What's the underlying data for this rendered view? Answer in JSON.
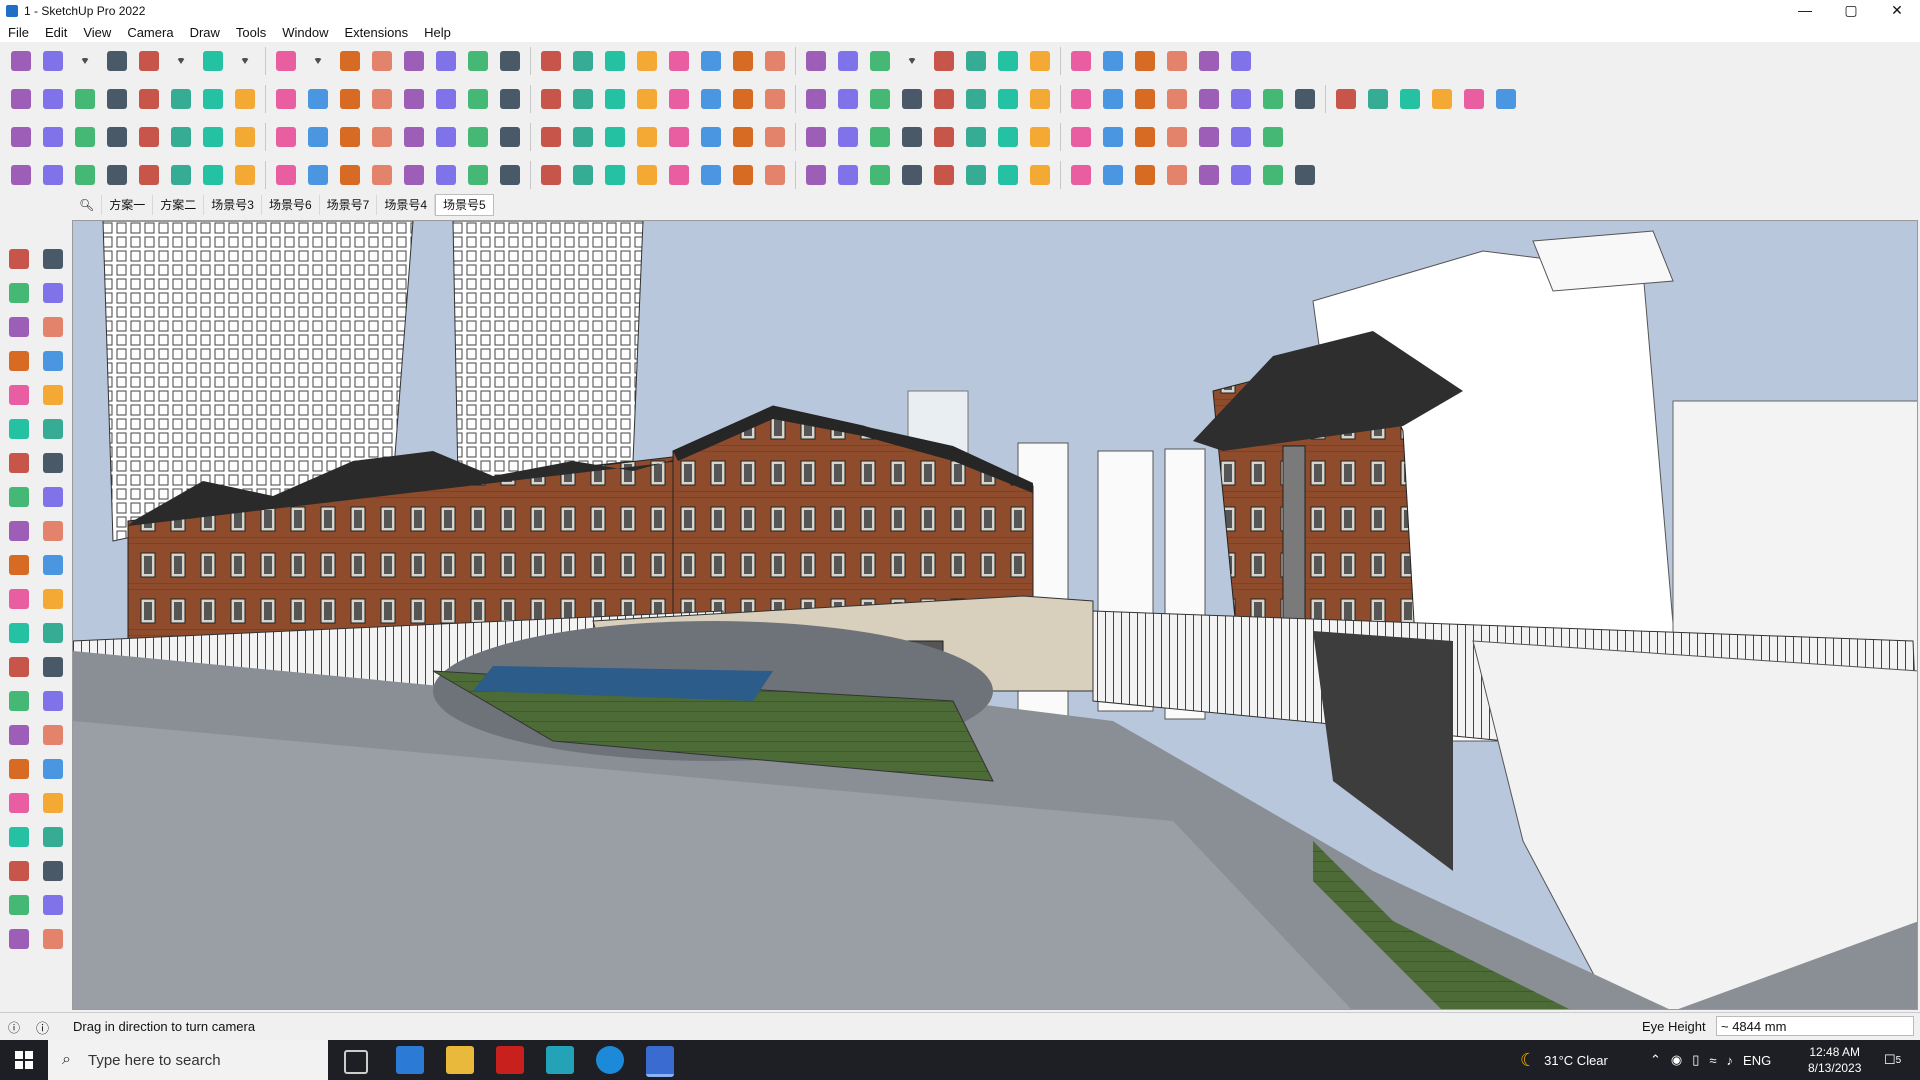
{
  "window": {
    "title": "1 - SketchUp Pro 2022",
    "minimize": "—",
    "maximize": "▢",
    "close": "✕"
  },
  "menu": [
    "File",
    "Edit",
    "View",
    "Camera",
    "Draw",
    "Tools",
    "Window",
    "Extensions",
    "Help"
  ],
  "toolbar_rows": {
    "row1": [
      "zoom-icon",
      "select-icon",
      "dropdown-icon",
      "eraser-icon",
      "line-icon",
      "dropdown-icon",
      "lasso-icon",
      "dropdown-icon",
      "rectangle-icon",
      "dropdown-icon",
      "push-pull-icon",
      "follow-me-icon",
      "move-icon",
      "rotate-icon",
      "scale-icon",
      "tape-measure-icon",
      "text-icon",
      "paint-bucket-icon",
      "orbit-icon",
      "pan-icon",
      "zoom-window-icon",
      "zoom-extents-icon",
      "iso-view-icon",
      "top-view-icon",
      "front-view-icon",
      "right-view-icon",
      "user-icon",
      "dropdown-icon",
      "warehouse-icon",
      "ext-warehouse-icon",
      "layout-icon",
      "upload-icon",
      "download-icon",
      "sandbox-icon",
      "section-icon",
      "undo-icon",
      "redo-icon",
      "ruby-icon"
    ],
    "row2": [
      "box-icon",
      "xray-icon",
      "hidden-line-icon",
      "tool-a-icon",
      "tool-b-icon",
      "tool-c-icon",
      "tool-d-icon",
      "tool-e-icon",
      "tool-f-icon",
      "tool-g-icon",
      "tool-h-icon",
      "arc-icon",
      "slash-a-icon",
      "slash-b-icon",
      "slash-c-icon",
      "shade-a-icon",
      "shade-b-icon",
      "house-a-icon",
      "house-b-icon",
      "house-c-icon",
      "house-d-icon",
      "house-e-icon",
      "house-f-icon",
      "font-icon",
      "hand-icon",
      "pen-icon",
      "shape-a-icon",
      "shape-b-icon",
      "shape-c-icon",
      "shape-d-icon",
      "shape-e-icon",
      "shape-f-icon",
      "shape-g-icon",
      "shape-h-icon",
      "shape-i-icon",
      "shape-j-icon",
      "shape-k-icon",
      "pencil-red-icon",
      "pencil-pink-icon",
      "misc-a-icon",
      "misc-b-icon",
      "misc-c-icon",
      "misc-d-icon",
      "misc-e-icon",
      "misc-f-icon",
      "misc-g-icon"
    ],
    "row3": [
      "r3-a-icon",
      "r3-b-icon",
      "r3-c-icon",
      "r3-d-icon",
      "r3-e-icon",
      "r3-f-icon",
      "r3-g-icon",
      "r3-h-icon",
      "r3-i-icon",
      "r3-j-icon",
      "r3-k-icon",
      "r3-l-icon",
      "r3-m-icon",
      "r3-n-icon",
      "r3-o-icon",
      "r3-p-icon",
      "r3-q-icon",
      "r3-r-icon",
      "r3-s-icon",
      "r3-t-icon",
      "r3-u-icon",
      "r3-v-icon",
      "r3-w-icon",
      "r3-x-icon",
      "r3-y-icon",
      "r3-z-icon",
      "r3-aa-icon",
      "r3-ab-icon",
      "r3-ac-icon",
      "r3-ad-icon",
      "r3-ae-icon",
      "r3-af-icon",
      "r3-ag-icon",
      "r3-ah-icon",
      "r3-ai-icon",
      "r3-aj-icon",
      "r3-ak-icon",
      "r3-al-icon",
      "r3-am-icon"
    ],
    "row4": [
      "r4-a-icon",
      "r4-b-icon",
      "r4-c-icon",
      "r4-d-icon",
      "r4-e-icon",
      "r4-f-icon",
      "r4-g-icon",
      "r4-h-icon",
      "r4-i-icon",
      "r4-j-icon",
      "r4-k-icon",
      "r4-l-icon",
      "r4-m-icon",
      "r4-n-icon",
      "r4-o-icon",
      "r4-p-icon",
      "r4-q-icon",
      "r4-r-icon",
      "r4-s-icon",
      "r4-t-icon",
      "r4-u-icon",
      "r4-v-icon",
      "r4-w-icon",
      "r4-x-icon",
      "r4-y-icon",
      "r4-z-icon",
      "r4-aa-icon",
      "r4-ab-icon",
      "r4-ac-icon",
      "r4-ad-icon",
      "r4-ae-icon",
      "r4-af-icon",
      "r4-ag-icon",
      "r4-ah-icon",
      "r4-ai-icon",
      "r4-aj-icon",
      "r4-ak-icon",
      "r4-al-icon",
      "r4-am-icon",
      "r4-an-icon"
    ]
  },
  "scenes": {
    "search_icon": "search-icon",
    "tabs": [
      "方案一",
      "方案二",
      "场景号3",
      "场景号6",
      "场景号7",
      "场景号4",
      "场景号5"
    ],
    "active": "场景号5"
  },
  "status": {
    "hint": "Drag in direction to turn camera",
    "eye_height_label": "Eye Height",
    "eye_height_value": "~ 4844 mm"
  },
  "taskbar": {
    "search_placeholder": "Type here to search",
    "weather": "31°C  Clear",
    "lang": "ENG",
    "time": "12:48 AM",
    "date": "8/13/2023",
    "notif_count": "5"
  },
  "colors": {
    "sky": "#b6c6da",
    "brick": "#8b4a2b",
    "roof": "#2b2b2b",
    "ground": "#8c9196",
    "grass": "#4c6a36",
    "white_tower": "#ffffff"
  }
}
